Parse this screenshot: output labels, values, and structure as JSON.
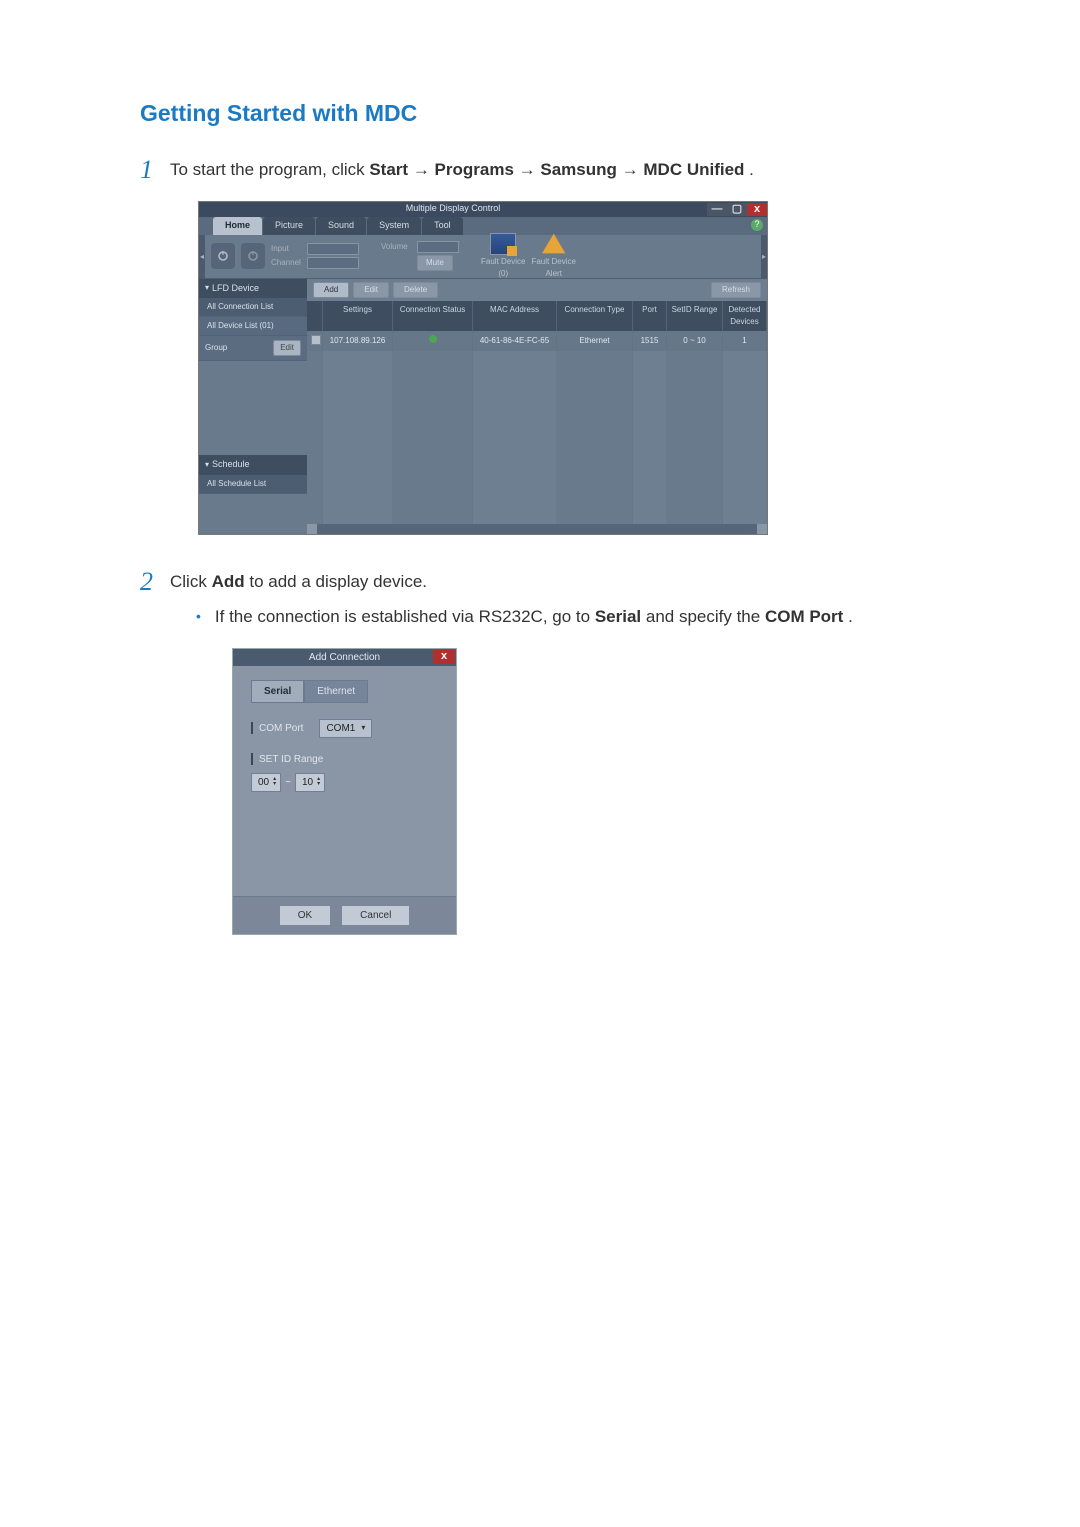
{
  "heading": "Getting Started with MDC",
  "step1": {
    "num": "1",
    "txt_a": "To start the program, click ",
    "start": "Start",
    "arrow": " → ",
    "programs": "Programs",
    "samsung": "Samsung",
    "unified": "MDC Unified",
    "period": "."
  },
  "app": {
    "title": "Multiple Display Control",
    "tabs": {
      "home": "Home",
      "picture": "Picture",
      "sound": "Sound",
      "system": "System",
      "tool": "Tool"
    },
    "ribbon": {
      "input_lbl": "Input",
      "channel_lbl": "Channel",
      "volume_lbl": "Volume",
      "mute_lbl": "Mute",
      "fault_device": "Fault Device\n(0)",
      "fault_alert": "Fault Device\nAlert"
    },
    "side": {
      "lfd": "LFD Device",
      "all_conn": "All Connection List",
      "all_dev": "All Device List (01)",
      "group": "Group",
      "edit": "Edit",
      "schedule": "Schedule",
      "all_sch": "All Schedule List"
    },
    "toolbar": {
      "add": "Add",
      "edit": "Edit",
      "delete": "Delete",
      "refresh": "Refresh"
    },
    "table": {
      "h0": "",
      "h1": "Settings",
      "h2": "Connection Status",
      "h3": "MAC Address",
      "h4": "Connection Type",
      "h5": "Port",
      "h6": "SetID Range",
      "h7": "Detected Devices",
      "r0": {
        "ip": "107.108.89.126",
        "status": "●",
        "mac": "40-61-86-4E-FC-65",
        "type": "Ethernet",
        "port": "1515",
        "range": "0 ~ 10",
        "det": "1"
      }
    }
  },
  "step2": {
    "num": "2",
    "before": "Click ",
    "add": "Add",
    "after": " to add a display device.",
    "bullet_before": "If the connection is established via RS232C, go to ",
    "serial": "Serial",
    "bullet_mid": " and specify the ",
    "comport": "COM Port",
    "bullet_after": "."
  },
  "dlg": {
    "title": "Add Connection",
    "tab_serial": "Serial",
    "tab_eth": "Ethernet",
    "com_port_lbl": "COM Port",
    "com_port_val": "COM1",
    "setid_lbl": "SET ID Range",
    "spin_lo": "00",
    "tilde": "~",
    "spin_hi": "10",
    "ok": "OK",
    "cancel": "Cancel"
  }
}
